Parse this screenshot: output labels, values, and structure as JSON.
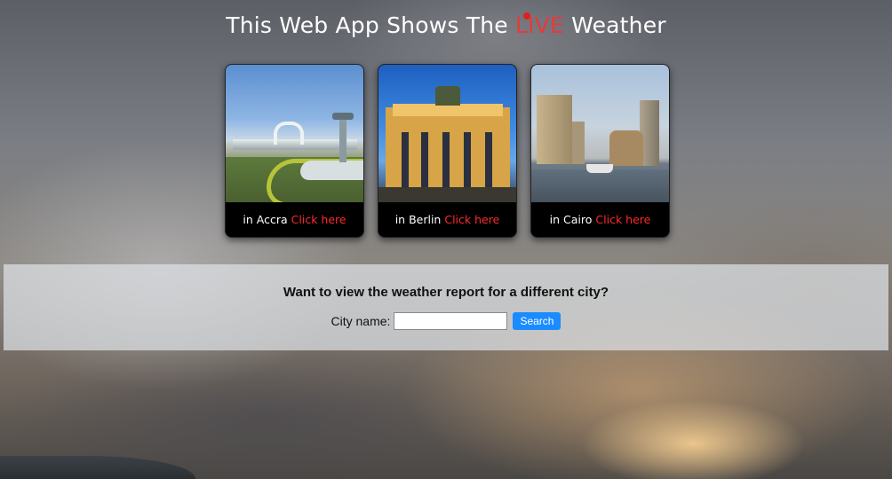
{
  "header": {
    "title_before": "This Web App Shows The ",
    "title_live": "LIVE",
    "title_after": " Weather"
  },
  "cards": [
    {
      "prefix": "in Accra",
      "link": "Click here"
    },
    {
      "prefix": "in Berlin",
      "link": "Click here"
    },
    {
      "prefix": "in Cairo",
      "link": "Click here"
    }
  ],
  "search": {
    "question": "Want to view the weather report for a different city?",
    "label": "City name:",
    "value": "",
    "placeholder": "",
    "button": "Search"
  },
  "colors": {
    "live_red": "#e8393a",
    "link_red": "#ff2a2a",
    "search_blue": "#1a8cff"
  }
}
